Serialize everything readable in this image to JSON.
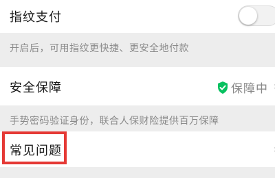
{
  "fingerprint": {
    "title": "指纹支付",
    "toggle_state": "off",
    "description": "开启后，可用指纹更快捷、更安全地付款"
  },
  "security": {
    "title": "安全保障",
    "status_icon": "shield-check-icon",
    "status_text": "保障中",
    "description": "手势密码验证身份，联合人保财险提供百万保障"
  },
  "faq": {
    "title": "常见问题"
  },
  "colors": {
    "shield_green": "#07c160",
    "highlight_red": "#e53935"
  }
}
